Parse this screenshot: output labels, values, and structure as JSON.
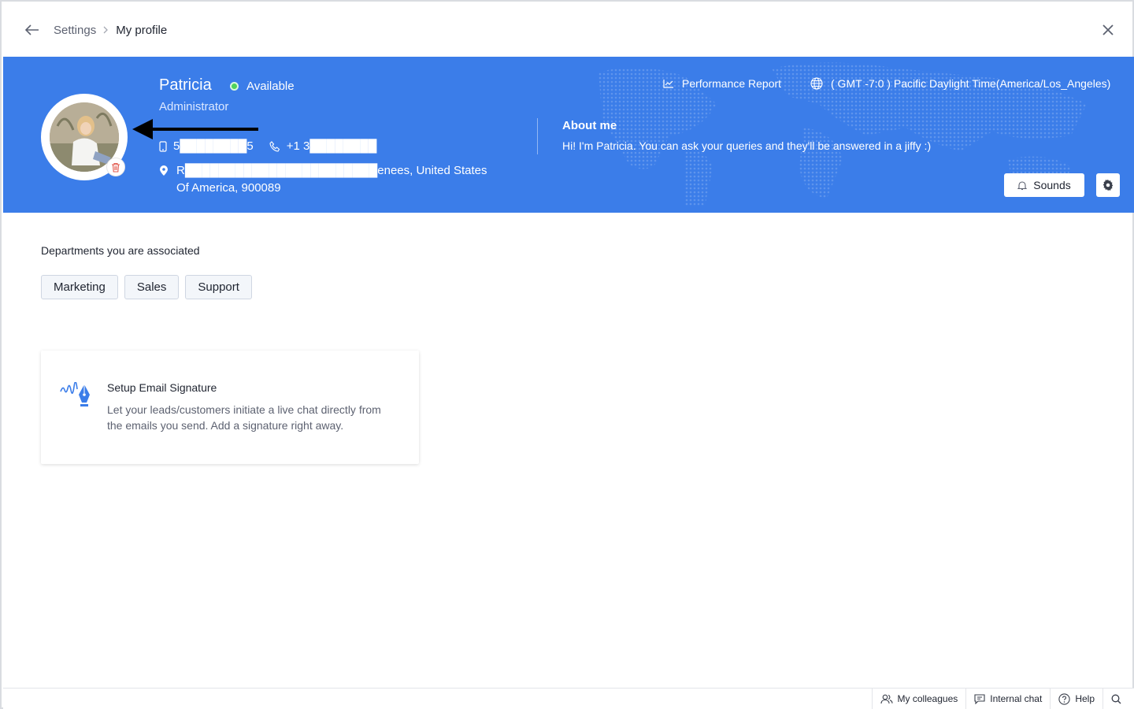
{
  "breadcrumb": {
    "parent": "Settings",
    "current": "My profile"
  },
  "profile": {
    "name": "Patricia",
    "status": "Available",
    "role": "Administrator",
    "mobile": "5████████5",
    "phone": "+1 3████████",
    "address": "R███████████████████████enees, United States Of America, 900089",
    "about_title": "About me",
    "about_text": "Hi! I'm Patricia. You can ask your queries and they'll be answered in a jiffy :)",
    "performance_label": "Performance Report",
    "timezone": "( GMT -7:0 ) Pacific Daylight Time(America/Los_Angeles)",
    "sounds_label": "Sounds"
  },
  "departments": {
    "title": "Departments you are associated",
    "items": [
      "Marketing",
      "Sales",
      "Support"
    ]
  },
  "signature_card": {
    "title": "Setup Email Signature",
    "description": "Let your leads/customers initiate a live chat directly from the emails you send. Add a signature right away."
  },
  "bottombar": {
    "colleagues": "My colleagues",
    "internal_chat": "Internal chat",
    "help": "Help"
  },
  "colors": {
    "banner": "#3b7de9",
    "status_dot": "#4fd35a",
    "delete_icon": "#e2584d"
  }
}
